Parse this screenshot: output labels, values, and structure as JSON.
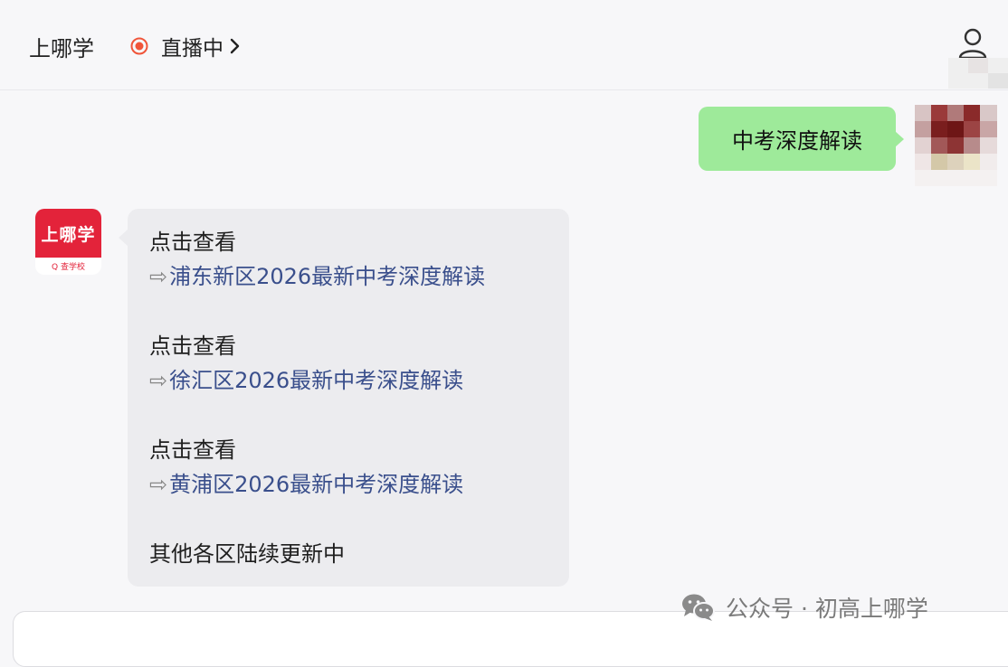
{
  "header": {
    "app_title": "上哪学",
    "live_label": "直播中",
    "live_icon": "live-dot-icon",
    "chevron_icon": "chevron-right-icon",
    "user_icon": "user-icon"
  },
  "chat": {
    "user_message": "中考深度解读",
    "bot_avatar": {
      "brand": "上哪学",
      "tagline": "Q 查学校"
    },
    "bot_message": [
      {
        "prompt": "点击查看",
        "arrow": "⇨",
        "link": "浦东新区2026最新中考深度解读"
      },
      {
        "prompt": "点击查看",
        "arrow": "⇨",
        "link": "徐汇区2026最新中考深度解读"
      },
      {
        "prompt": "点击查看",
        "arrow": "⇨",
        "link": "黄浦区2026最新中考深度解读"
      }
    ],
    "footer_note": "其他各区陆续更新中"
  },
  "watermark": {
    "text": "公众号 · 初高上哪学",
    "icon": "wechat-icon"
  },
  "colors": {
    "user_bubble": "#9eea9a",
    "bot_bubble": "#ececef",
    "link": "#3a4f8c",
    "live_dot": "#f0553a",
    "brand_red": "#e3233a"
  }
}
